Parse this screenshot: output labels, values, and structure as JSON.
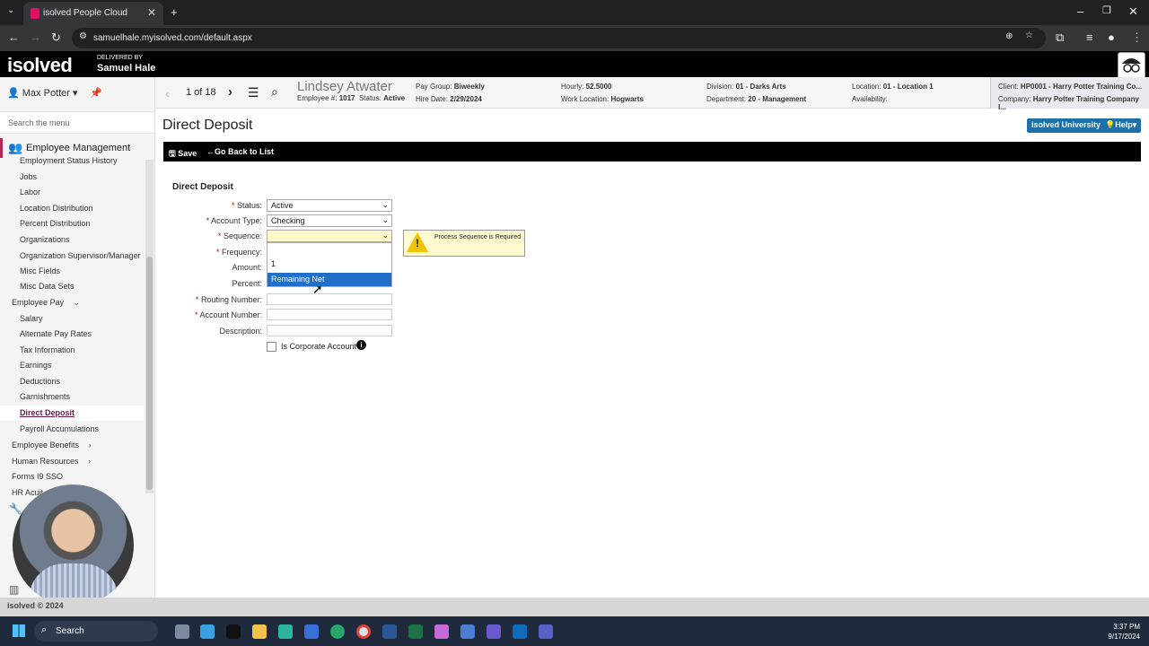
{
  "browser": {
    "tab_title": "isolved People Cloud",
    "url": "samuelhale.myisolved.com/default.aspx"
  },
  "header": {
    "logo": "isolved",
    "delivered_by": "DELIVERED BY",
    "delivered_name": "Samuel Hale"
  },
  "sidebar": {
    "user": "Max Potter",
    "search_placeholder": "Search the menu",
    "section": "Employee Management",
    "items": [
      {
        "label": "Employment Status History"
      },
      {
        "label": "Jobs"
      },
      {
        "label": "Labor"
      },
      {
        "label": "Location Distribution"
      },
      {
        "label": "Percent Distribution"
      },
      {
        "label": "Organizations"
      },
      {
        "label": "Organization Supervisor/Manager"
      },
      {
        "label": "Misc Fields"
      },
      {
        "label": "Misc Data Sets"
      },
      {
        "label": "Employee Pay"
      },
      {
        "label": "Salary"
      },
      {
        "label": "Alternate Pay Rates"
      },
      {
        "label": "Tax Information"
      },
      {
        "label": "Earnings"
      },
      {
        "label": "Deductions"
      },
      {
        "label": "Garnishments"
      },
      {
        "label": "Direct Deposit"
      },
      {
        "label": "Payroll Accumulations"
      },
      {
        "label": "Employee Benefits"
      },
      {
        "label": "Human Resources"
      },
      {
        "label": "Forms I9 SSO"
      },
      {
        "label": "HR Acuit"
      }
    ]
  },
  "employee_bar": {
    "pager": "1 of 18",
    "name": "Lindsey Atwater",
    "employee_no_label": "Employee #:",
    "employee_no": "1017",
    "status_label": "Status:",
    "status": "Active",
    "pay_group_label": "Pay Group:",
    "pay_group": "Biweekly",
    "hire_date_label": "Hire Date:",
    "hire_date": "2/29/2024",
    "hourly_label": "Hourly:",
    "hourly": "52.5000",
    "work_location_label": "Work Location:",
    "work_location": "Hogwarts",
    "division_label": "Division:",
    "division": "01 - Darks Arts",
    "department_label": "Department:",
    "department": "20 - Management",
    "location_label": "Location:",
    "location": "01 - Location 1",
    "availability_label": "Availability:",
    "client_label": "Client:",
    "client": "HP0001 - Harry Potter Training Co...",
    "company_label": "Company:",
    "company": "Harry Potter Training Company I..."
  },
  "page": {
    "title": "Direct Deposit",
    "btn_university": "isolved University",
    "btn_help": "Help",
    "toolbar_save": "Save",
    "toolbar_back": "Go Back to List",
    "form_title": "Direct Deposit"
  },
  "form": {
    "status_label": "Status:",
    "status_value": "Active",
    "account_type_label": "Account Type:",
    "account_type_value": "Checking",
    "sequence_label": "Sequence:",
    "sequence_value": "",
    "frequency_label": "Frequency:",
    "amount_label": "Amount:",
    "percent_label": "Percent:",
    "routing_label": "Routing Number:",
    "account_label": "Account Number:",
    "description_label": "Description:",
    "corporate_label": "Is Corporate Account",
    "sequence_options": [
      "",
      "1",
      "Remaining Net"
    ],
    "validation_message": "Process Sequence is Required"
  },
  "footer": {
    "text": "isolved © 2024"
  },
  "taskbar": {
    "search": "Search",
    "time": "3:37 PM",
    "date": "9/17/2024"
  },
  "colors": {
    "brand_magenta": "#b5295f",
    "button_blue": "#1d6fa9",
    "selected_option": "#1f6ec7"
  }
}
